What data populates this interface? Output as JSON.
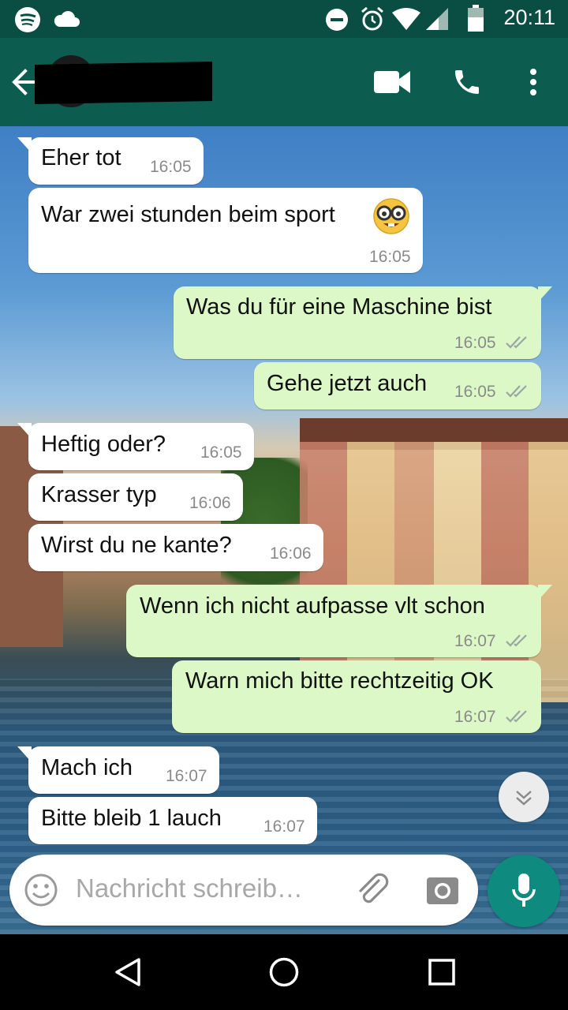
{
  "status_bar": {
    "time": "20:11",
    "icons": [
      "spotify-icon",
      "cloud-icon",
      "do-not-disturb-icon",
      "alarm-icon",
      "wifi-icon",
      "signal-icon",
      "battery-icon"
    ]
  },
  "app_bar": {
    "back_icon": "back-arrow-icon",
    "actions": [
      "video-call-icon",
      "phone-icon",
      "more-vert-icon"
    ]
  },
  "messages": [
    {
      "direction": "in",
      "text": "Eher tot",
      "time": "16:05"
    },
    {
      "direction": "in",
      "text": "War zwei stunden beim sport",
      "emoji": "🤓",
      "time": "16:05"
    },
    {
      "direction": "out",
      "text": "Was du für eine Maschine bist",
      "time": "16:05",
      "status": "read"
    },
    {
      "direction": "out",
      "text": "Gehe jetzt auch",
      "time": "16:05",
      "status": "read"
    },
    {
      "direction": "in",
      "text": "Heftig oder?",
      "time": "16:05"
    },
    {
      "direction": "in",
      "text": "Krasser typ",
      "time": "16:06"
    },
    {
      "direction": "in",
      "text": "Wirst du ne kante?",
      "time": "16:06"
    },
    {
      "direction": "out",
      "text": "Wenn ich nicht aufpasse vlt schon",
      "time": "16:07",
      "status": "read"
    },
    {
      "direction": "out",
      "text": "Warn mich bitte rechtzeitig OK",
      "time": "16:07",
      "status": "read"
    },
    {
      "direction": "in",
      "text": "Mach ich",
      "time": "16:07"
    },
    {
      "direction": "in",
      "text": "Bitte bleib 1 lauch",
      "time": "16:07"
    }
  ],
  "composer": {
    "placeholder": "Nachricht schreib…",
    "icons": [
      "emoji-icon",
      "attach-icon",
      "camera-icon",
      "mic-icon"
    ]
  },
  "nav_bar": {
    "icons": [
      "back-triangle-icon",
      "home-circle-icon",
      "recents-square-icon"
    ]
  },
  "colors": {
    "header": "#0c5c4f",
    "status_bar": "#0a4d42",
    "incoming_bubble": "#ffffff",
    "outgoing_bubble": "#dcf8c6",
    "accent": "#0f8a7e",
    "read_ticks": "#9aa7a0"
  }
}
